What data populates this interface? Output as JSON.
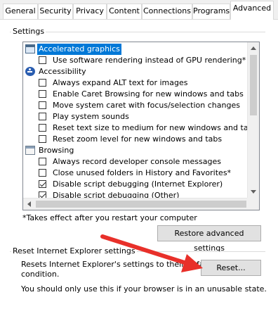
{
  "tabs": [
    {
      "label": "General"
    },
    {
      "label": "Security"
    },
    {
      "label": "Privacy"
    },
    {
      "label": "Content"
    },
    {
      "label": "Connections"
    },
    {
      "label": "Programs"
    },
    {
      "label": "Advanced"
    }
  ],
  "settings": {
    "group_label": "Settings",
    "tree": [
      {
        "type": "category",
        "icon": "accelerated-graphics-icon",
        "label": "Accelerated graphics",
        "selected": true
      },
      {
        "type": "option",
        "checked": false,
        "label": "Use software rendering instead of GPU rendering*"
      },
      {
        "type": "category",
        "icon": "accessibility-icon",
        "label": "Accessibility"
      },
      {
        "type": "option",
        "checked": false,
        "label": "Always expand ALT text for images"
      },
      {
        "type": "option",
        "checked": false,
        "label": "Enable Caret Browsing for new windows and tabs"
      },
      {
        "type": "option",
        "checked": false,
        "label": "Move system caret with focus/selection changes"
      },
      {
        "type": "option",
        "checked": false,
        "label": "Play system sounds"
      },
      {
        "type": "option",
        "checked": false,
        "label": "Reset text size to medium for new windows and tabs"
      },
      {
        "type": "option",
        "checked": false,
        "label": "Reset zoom level for new windows and tabs"
      },
      {
        "type": "category",
        "icon": "browsing-icon",
        "label": "Browsing"
      },
      {
        "type": "option",
        "checked": false,
        "label": "Always record developer console messages"
      },
      {
        "type": "option",
        "checked": false,
        "label": "Close unused folders in History and Favorites*"
      },
      {
        "type": "option",
        "checked": true,
        "label": "Disable script debugging (Internet Explorer)"
      },
      {
        "type": "option",
        "checked": true,
        "label": "Disable script debugging (Other)"
      }
    ],
    "restart_note": "*Takes effect after you restart your computer",
    "restore_button": "Restore advanced settings"
  },
  "reset": {
    "group_label": "Reset Internet Explorer settings",
    "description_line1": "Resets Internet Explorer's settings to their default",
    "description_line2": "condition.",
    "button": "Reset...",
    "warning": "You should only use this if your browser is in an unusable state."
  },
  "colors": {
    "selection": "#0078d7",
    "annotation_arrow": "#e8302a"
  }
}
